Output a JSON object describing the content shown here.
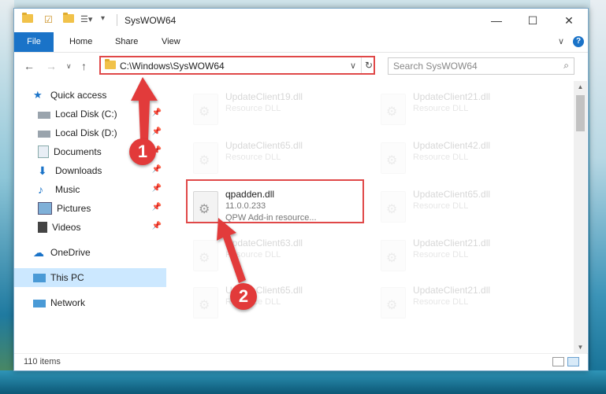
{
  "window": {
    "title": "SysWOW64",
    "controls": {
      "minimize": "—",
      "maximize": "☐",
      "close": "✕"
    }
  },
  "ribbon": {
    "tabs": [
      "File",
      "Home",
      "Share",
      "View"
    ],
    "expand": "∨",
    "help": "?"
  },
  "address": {
    "path": "C:\\Windows\\SysWOW64",
    "search_placeholder": "Search SysWOW64"
  },
  "nav_pane": {
    "items": [
      {
        "label": "Quick access",
        "icon": "star-icon",
        "pinned": false
      },
      {
        "label": "Local Disk (C:)",
        "icon": "disk-icon",
        "pinned": true
      },
      {
        "label": "Local Disk (D:)",
        "icon": "disk-icon",
        "pinned": true
      },
      {
        "label": "Documents",
        "icon": "documents-icon",
        "pinned": true
      },
      {
        "label": "Downloads",
        "icon": "download-icon",
        "pinned": true
      },
      {
        "label": "Music",
        "icon": "music-icon",
        "pinned": true
      },
      {
        "label": "Pictures",
        "icon": "pictures-icon",
        "pinned": true
      },
      {
        "label": "Videos",
        "icon": "videos-icon",
        "pinned": true
      },
      {
        "label": "OneDrive",
        "icon": "cloud-icon",
        "pinned": false
      },
      {
        "label": "This PC",
        "icon": "computer-icon",
        "pinned": false,
        "selected": true
      },
      {
        "label": "Network",
        "icon": "network-icon",
        "pinned": false
      }
    ]
  },
  "files": [
    {
      "name": "UpdateClient19.dll",
      "line1": "Resource DLL",
      "line2": "",
      "faded": true
    },
    {
      "name": "UpdateClient21.dll",
      "line1": "Resource DLL",
      "line2": "",
      "faded": true
    },
    {
      "name": "UpdateClient65.dll",
      "line1": "Resource DLL",
      "line2": "",
      "faded": true
    },
    {
      "name": "UpdateClient42.dll",
      "line1": "Resource DLL",
      "line2": "",
      "faded": true
    },
    {
      "name": "qpadden.dll",
      "line1": "11.0.0.233",
      "line2": "QPW Add-in resource...",
      "faded": false
    },
    {
      "name": "UpdateClient65.dll",
      "line1": "Resource DLL",
      "line2": "",
      "faded": true
    },
    {
      "name": "UpdateClient63.dll",
      "line1": "Resource DLL",
      "line2": "",
      "faded": true
    },
    {
      "name": "UpdateClient21.dll",
      "line1": "Resource DLL",
      "line2": "",
      "faded": true
    },
    {
      "name": "UpdateClient65.dll",
      "line1": "Resource DLL",
      "line2": "",
      "faded": true
    },
    {
      "name": "UpdateClient21.dll",
      "line1": "Resource DLL",
      "line2": "",
      "faded": true
    }
  ],
  "status": {
    "item_count": "110 items"
  },
  "annotations": {
    "step1": "1",
    "step2": "2"
  },
  "colors": {
    "accent": "#1a73c8",
    "highlight": "#e04848",
    "selected": "#cce8ff"
  }
}
